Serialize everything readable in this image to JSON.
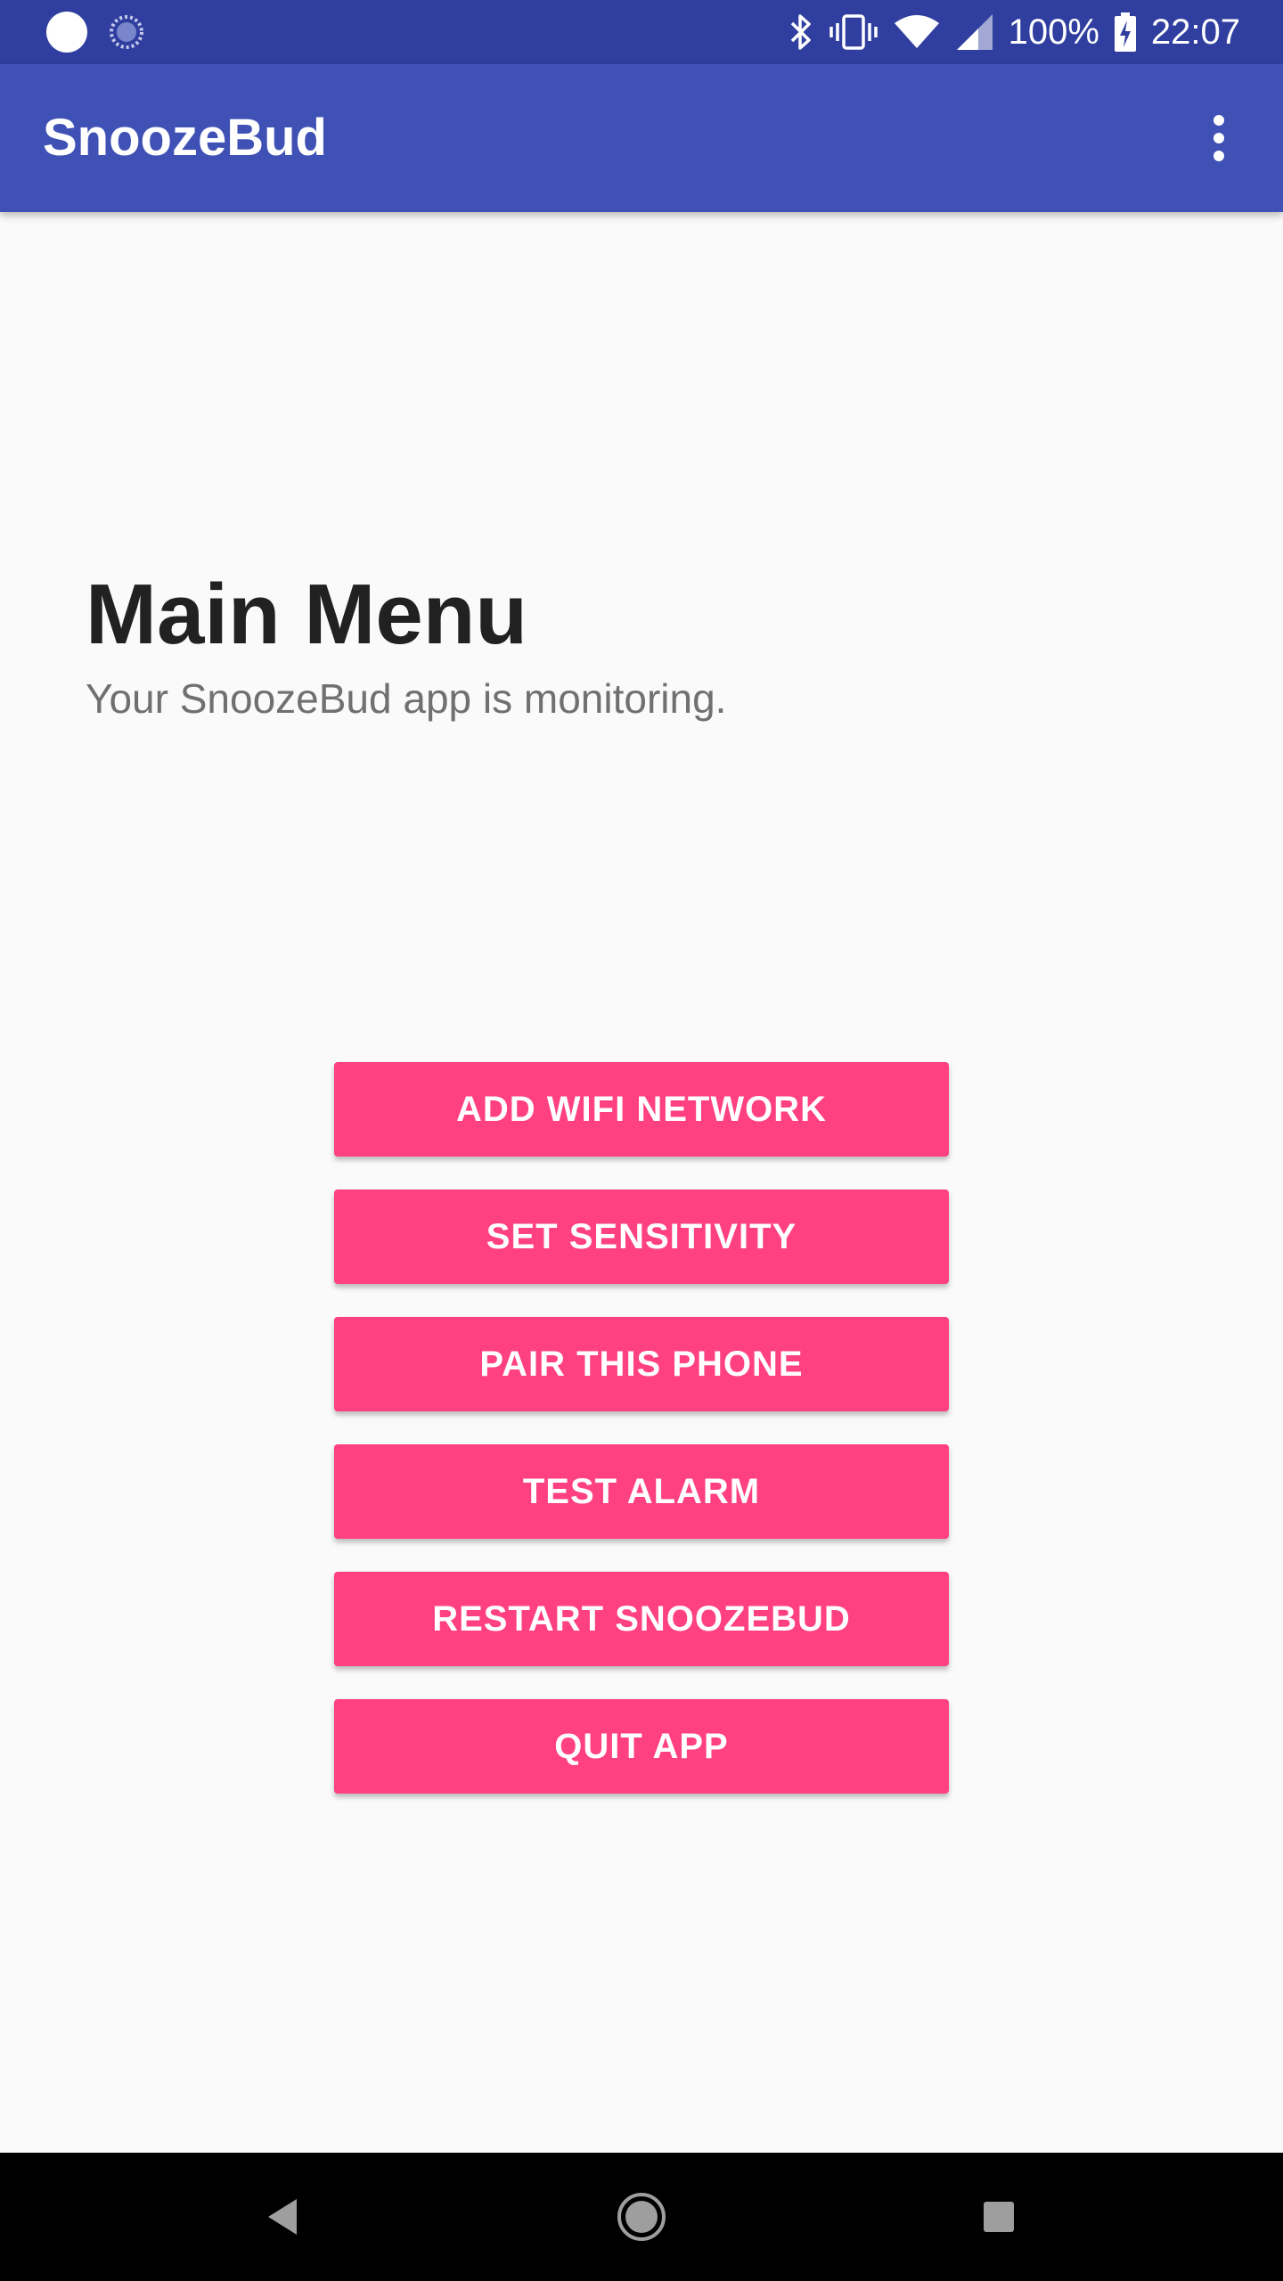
{
  "status_bar": {
    "battery": "100%",
    "time": "22:07",
    "icons": [
      "notification-dot-icon",
      "sync-icon",
      "bluetooth-icon",
      "vibrate-icon",
      "wifi-icon",
      "cellular-signal-icon",
      "battery-charging-icon"
    ]
  },
  "app_bar": {
    "title": "SnoozeBud",
    "overflow_icon": "more-vert-icon"
  },
  "main": {
    "headline": "Main Menu",
    "subhead": "Your SnoozeBud app is monitoring.",
    "buttons": [
      {
        "label": "ADD WIFI NETWORK"
      },
      {
        "label": "SET SENSITIVITY"
      },
      {
        "label": "PAIR THIS PHONE"
      },
      {
        "label": "TEST ALARM"
      },
      {
        "label": "RESTART SNOOZEBUD"
      },
      {
        "label": "QUIT APP"
      }
    ]
  },
  "nav_bar": {
    "icons": [
      "back-icon",
      "home-icon",
      "recents-icon"
    ]
  },
  "colors": {
    "status_bar": "#303f9f",
    "app_bar": "#3f51b5",
    "accent": "#ff4081",
    "background": "#fafafa"
  }
}
